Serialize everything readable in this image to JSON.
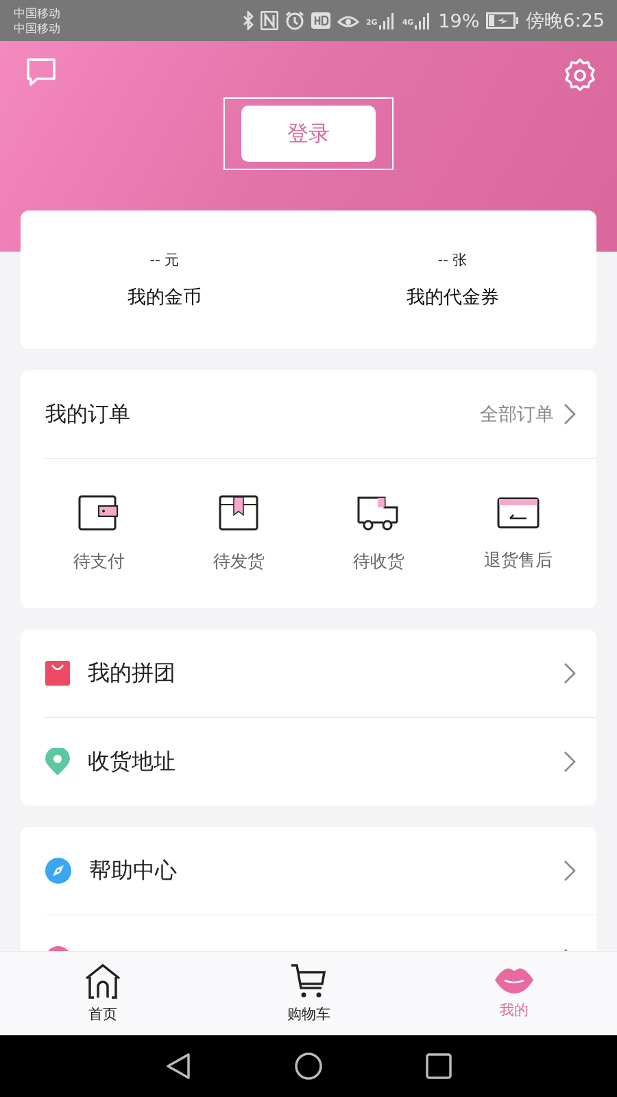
{
  "status_bar": {
    "carriers": [
      "中国移动",
      "中国移动"
    ],
    "network_2g": "2G",
    "network_4g": "4G",
    "battery": "19%",
    "time": "傍晚6:25"
  },
  "header": {
    "login_button": "登录"
  },
  "assets": [
    {
      "value": "-- 元",
      "label": "我的金币"
    },
    {
      "value": "-- 张",
      "label": "我的代金券"
    }
  ],
  "orders": {
    "title": "我的订单",
    "all_link": "全部订单",
    "items": [
      {
        "kind": "wallet",
        "label": "待支付"
      },
      {
        "kind": "box",
        "label": "待发货"
      },
      {
        "kind": "truck",
        "label": "待收货"
      },
      {
        "kind": "refund",
        "label": "退货售后"
      }
    ]
  },
  "menu_groups": [
    [
      {
        "kind": "bag",
        "label": "我的拼团"
      },
      {
        "kind": "pin",
        "label": "收货地址"
      }
    ],
    [
      {
        "kind": "compass",
        "label": "帮助中心"
      },
      {
        "kind": "circle"
      }
    ]
  ],
  "tabs": [
    {
      "kind": "home",
      "label": "首页",
      "selected": false
    },
    {
      "kind": "cart",
      "label": "购物车",
      "selected": false
    },
    {
      "kind": "lips",
      "label": "我的",
      "selected": true
    }
  ]
}
